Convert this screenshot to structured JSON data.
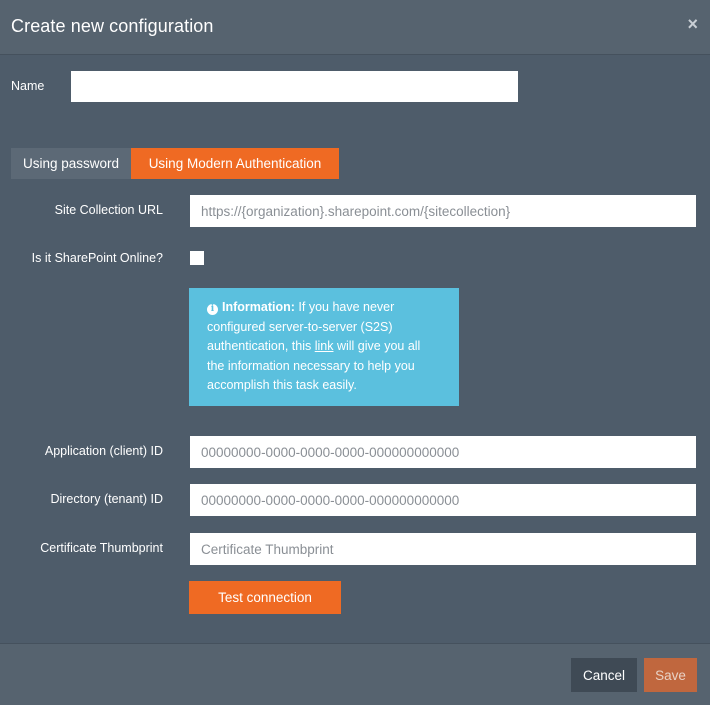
{
  "dialog": {
    "title": "Create new configuration",
    "close_glyph": "×"
  },
  "name_field": {
    "label": "Name",
    "value": "",
    "placeholder": ""
  },
  "tabs": [
    {
      "label": "Using password",
      "active": false
    },
    {
      "label": "Using Modern Authentication",
      "active": true
    }
  ],
  "site_url": {
    "label": "Site Collection URL",
    "value": "",
    "placeholder": "https://{organization}.sharepoint.com/{sitecollection}"
  },
  "sharepoint_online": {
    "label": "Is it SharePoint Online?",
    "checked": false
  },
  "info_box": {
    "icon": "info-icon",
    "heading": "Information:",
    "text_before_link": " If you have never configured server-to-server (S2S) authentication, this ",
    "link_text": "link",
    "text_after_link": " will give you all the information necessary to help you accomplish this task easily."
  },
  "client_id": {
    "label": "Application (client) ID",
    "value": "",
    "placeholder": "00000000-0000-0000-0000-000000000000"
  },
  "tenant_id": {
    "label": "Directory (tenant) ID",
    "value": "",
    "placeholder": "00000000-0000-0000-0000-000000000000"
  },
  "thumbprint": {
    "label": "Certificate Thumbprint",
    "value": "",
    "placeholder": "Certificate Thumbprint"
  },
  "buttons": {
    "test": "Test connection",
    "cancel": "Cancel",
    "save": "Save"
  },
  "colors": {
    "accent": "#ef6a23",
    "info": "#5bc0de",
    "background": "#4e5c6a"
  }
}
